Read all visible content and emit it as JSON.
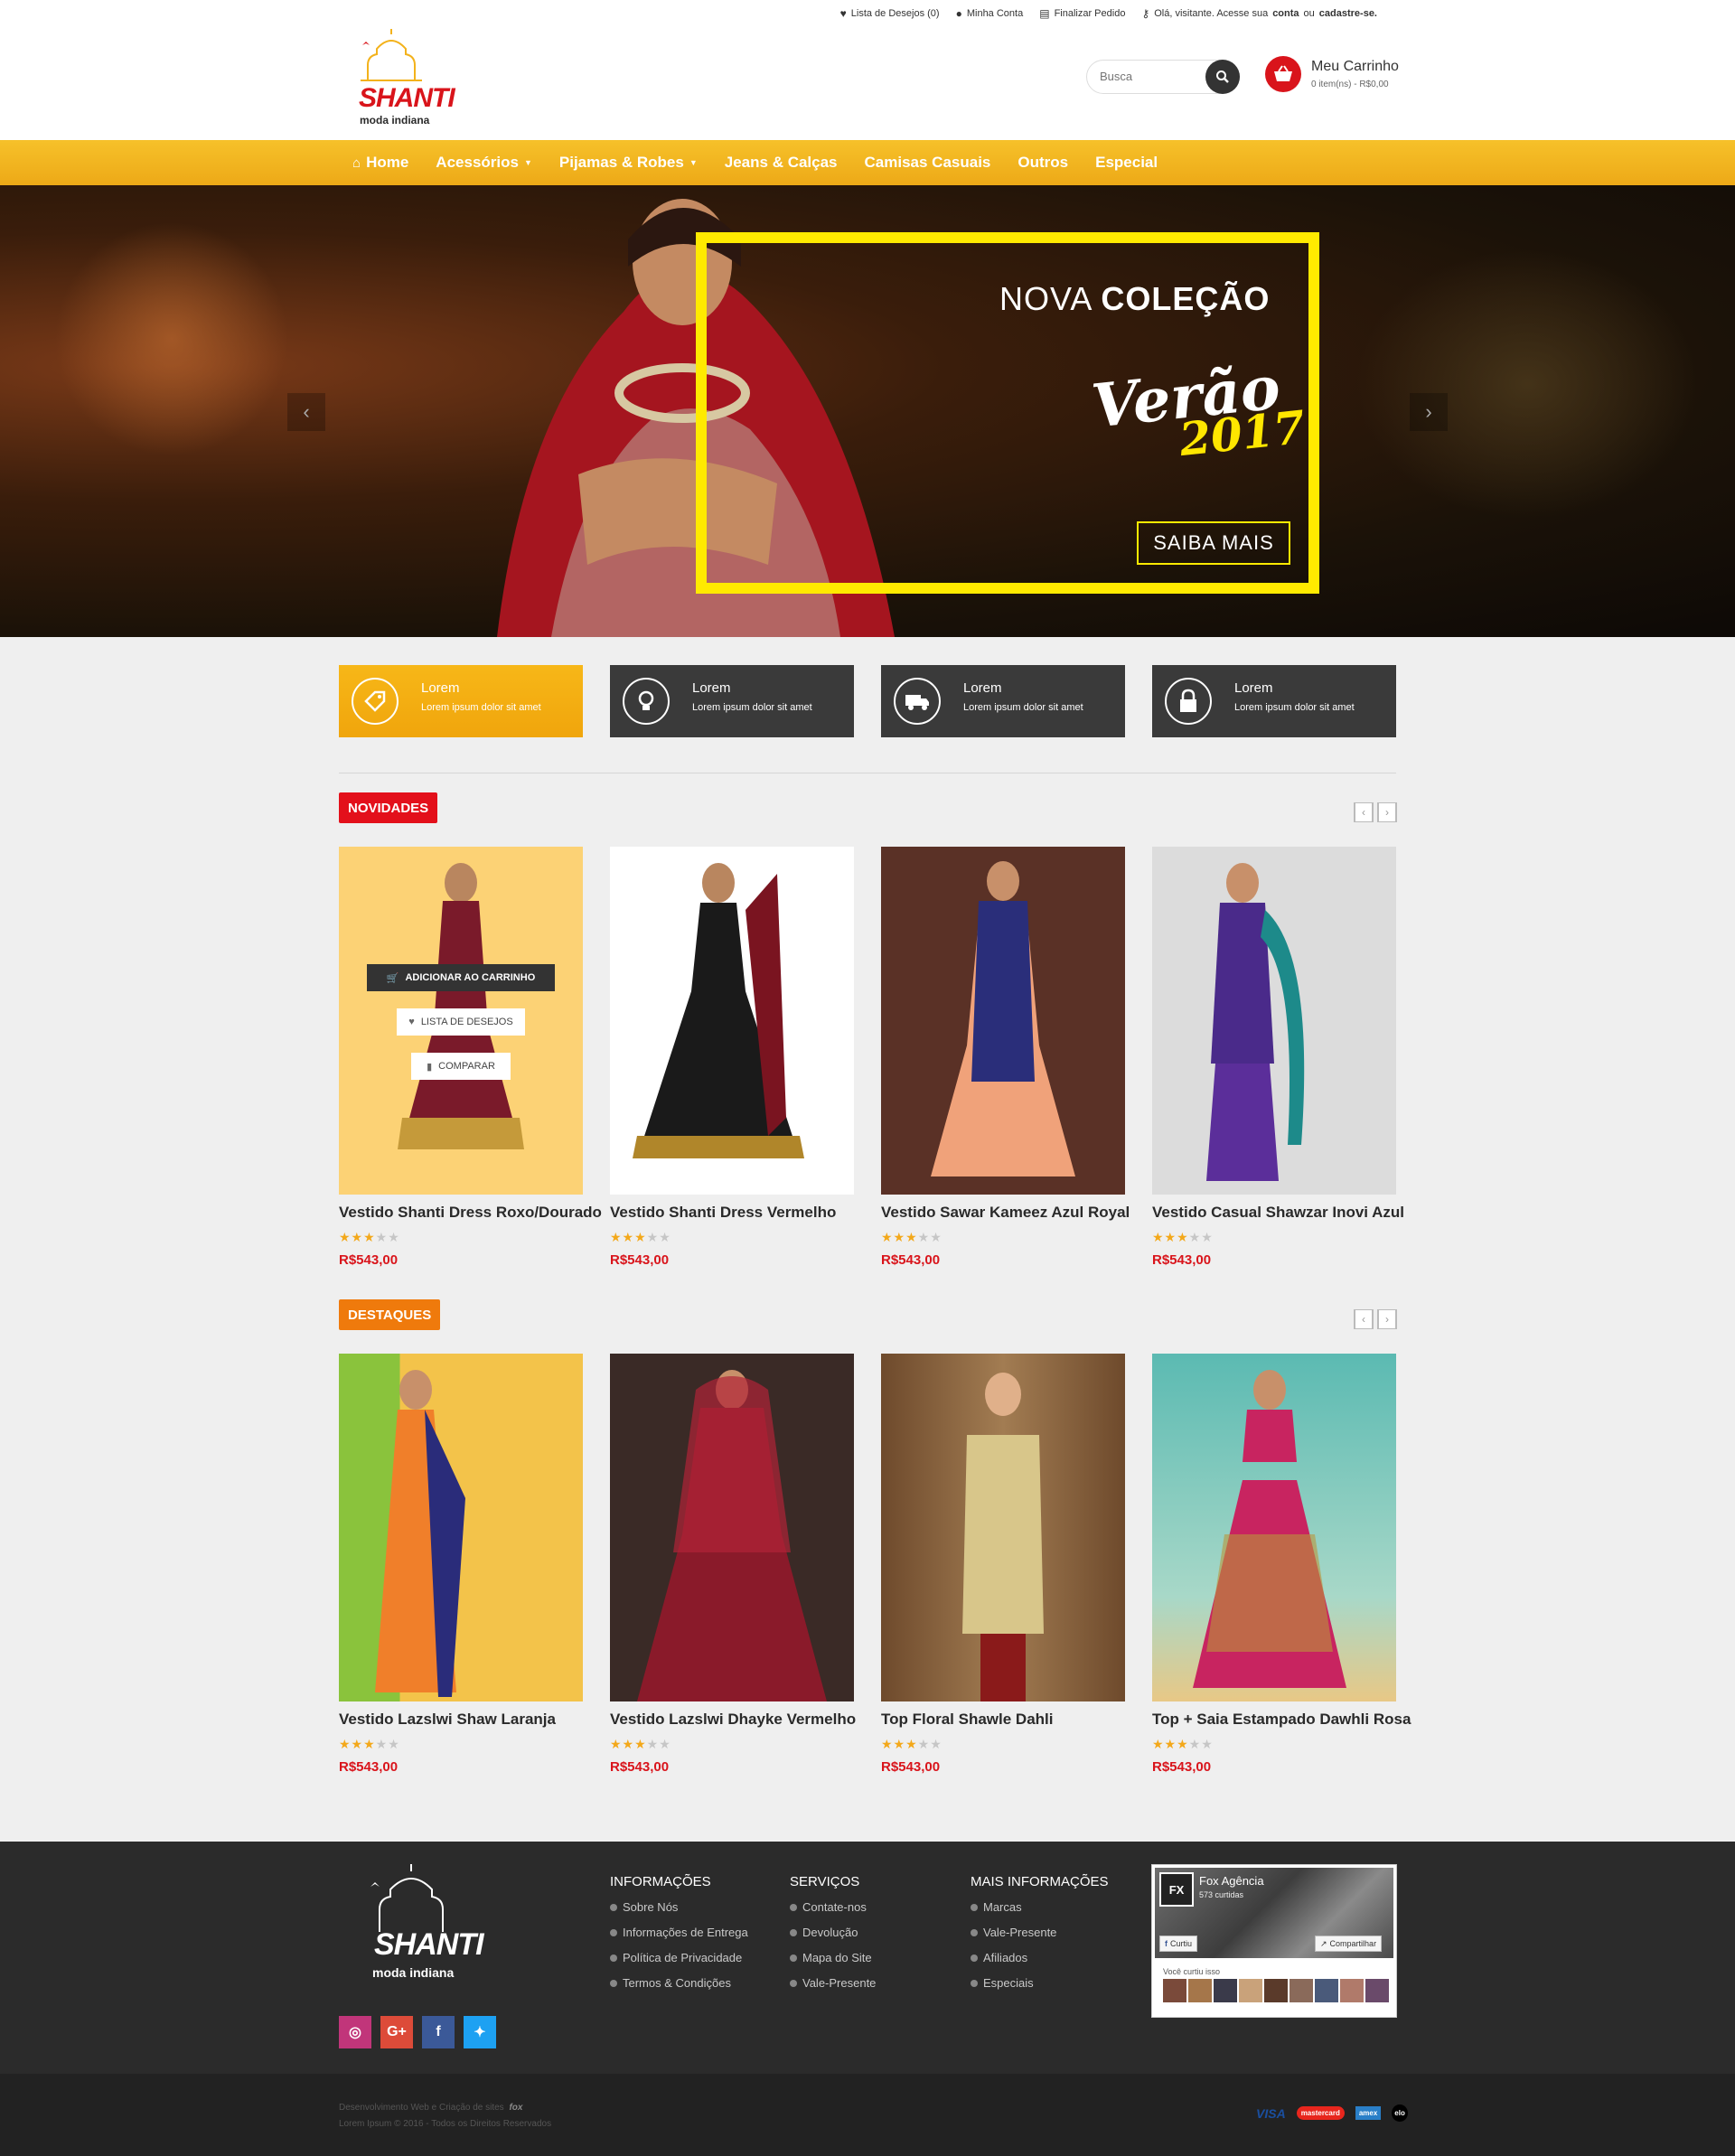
{
  "topbar": {
    "wishlist": "Lista de Desejos (0)",
    "account": "Minha Conta",
    "checkout": "Finalizar Pedido",
    "welcome_prefix": "Olá, visitante. Acesse sua",
    "welcome_login": "conta",
    "welcome_or": "ou",
    "welcome_register": "cadastre-se."
  },
  "header": {
    "logo_top": "SHANTI",
    "logo_bottom": "moda indiana",
    "search_placeholder": "Busca",
    "cart_title": "Meu Carrinho",
    "cart_summary": "0 item(ns) - R$0,00"
  },
  "nav": {
    "items": [
      {
        "label": "Home",
        "icon": "home-icon"
      },
      {
        "label": "Acessórios",
        "dropdown": true
      },
      {
        "label": "Pijamas & Robes",
        "dropdown": true
      },
      {
        "label": "Jeans & Calças"
      },
      {
        "label": "Camisas Casuais"
      },
      {
        "label": "Outros"
      },
      {
        "label": "Especial"
      }
    ]
  },
  "hero": {
    "title_light": "NOVA",
    "title_bold": "COLEÇÃO",
    "script_word": "Verão",
    "script_year": "2017",
    "cta": "SAIBA MAIS",
    "accent_color": "#ffea00"
  },
  "features": [
    {
      "title": "Lorem",
      "desc": "Lorem ipsum dolor sit amet",
      "icon": "tag-icon",
      "active": true
    },
    {
      "title": "Lorem",
      "desc": "Lorem ipsum dolor sit amet",
      "icon": "lightbulb-icon",
      "active": false
    },
    {
      "title": "Lorem",
      "desc": "Lorem ipsum dolor sit amet",
      "icon": "truck-icon",
      "active": false
    },
    {
      "title": "Lorem",
      "desc": "Lorem ipsum dolor sit amet",
      "icon": "lock-icon",
      "active": false
    }
  ],
  "novidades": {
    "label": "NOVIDADES",
    "hover": {
      "add_to_cart": "ADICIONAR AO CARRINHO",
      "wishlist": "LISTA DE DESEJOS",
      "compare": "COMPARAR"
    },
    "products": [
      {
        "name": "Vestido Shanti Dress Roxo/Dourado",
        "rating": 3,
        "price": "R$543,00"
      },
      {
        "name": "Vestido Shanti Dress Vermelho",
        "rating": 3,
        "price": "R$543,00"
      },
      {
        "name": "Vestido Sawar Kameez Azul Royal",
        "rating": 3,
        "price": "R$543,00"
      },
      {
        "name": "Vestido Casual Shawzar Inovi Azul",
        "rating": 3,
        "price": "R$543,00"
      }
    ]
  },
  "destaques": {
    "label": "DESTAQUES",
    "products": [
      {
        "name": "Vestido Lazslwi Shaw Laranja",
        "rating": 3,
        "price": "R$543,00"
      },
      {
        "name": "Vestido Lazslwi Dhayke Vermelho",
        "rating": 3,
        "price": "R$543,00"
      },
      {
        "name": "Top Floral Shawle Dahli",
        "rating": 3,
        "price": "R$543,00"
      },
      {
        "name": "Top + Saia Estampado Dawhli Rosa",
        "rating": 3,
        "price": "R$543,00"
      }
    ]
  },
  "footer": {
    "columns": [
      {
        "title": "INFORMAÇÕES",
        "links": [
          "Sobre Nós",
          "Informações de Entrega",
          "Política de Privacidade",
          "Termos & Condições"
        ]
      },
      {
        "title": "SERVIÇOS",
        "links": [
          "Contate-nos",
          "Devolução",
          "Mapa do Site",
          "Vale-Presente"
        ]
      },
      {
        "title": "MAIS INFORMAÇÕES",
        "links": [
          "Marcas",
          "Vale-Presente",
          "Afiliados",
          "Especiais"
        ]
      }
    ],
    "social": [
      {
        "icon": "instagram-icon",
        "color": "#c1357a"
      },
      {
        "icon": "google-plus-icon",
        "color": "#dd4b39"
      },
      {
        "icon": "facebook-icon",
        "color": "#3b5998"
      },
      {
        "icon": "twitter-icon",
        "color": "#1da1f2"
      }
    ],
    "facebook": {
      "page_name": "Fox Agência",
      "likes": "573 curtidas",
      "like_button": "Curtiu",
      "share_button": "Compartilhar",
      "friends_text": "Você curtiu isso"
    },
    "copyright_1": "Desenvolvimento Web e Criação de sites",
    "copyright_2": "Lorem Ipsum © 2016 - Todos os Direitos Reservados",
    "payments": [
      "VISA",
      "mastercard",
      "amex",
      "elo"
    ]
  }
}
